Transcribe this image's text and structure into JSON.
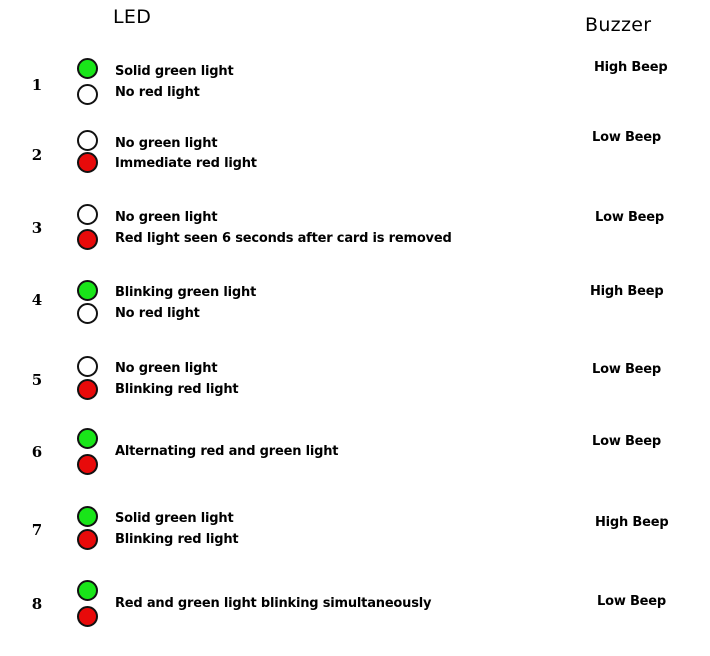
{
  "headers": {
    "led": "LED",
    "buzzer": "Buzzer"
  },
  "colors": {
    "green_on": "#19e519",
    "red_on": "#e80a0a",
    "off": "#ffffff",
    "outline": "#111111"
  },
  "rows": [
    {
      "number": "1",
      "green": "on",
      "red": "off",
      "lines": [
        "Solid green light",
        "No red light"
      ],
      "buzzer": "High Beep"
    },
    {
      "number": "2",
      "green": "off",
      "red": "on",
      "lines": [
        "No green light",
        "Immediate red light"
      ],
      "buzzer": "Low Beep"
    },
    {
      "number": "3",
      "green": "off",
      "red": "on",
      "lines": [
        "No green light",
        "Red light seen 6 seconds after card is removed"
      ],
      "buzzer": "Low Beep"
    },
    {
      "number": "4",
      "green": "on",
      "red": "off",
      "lines": [
        "Blinking green light",
        "No red light"
      ],
      "buzzer": "High Beep"
    },
    {
      "number": "5",
      "green": "off",
      "red": "on",
      "lines": [
        "No green light",
        "Blinking red light"
      ],
      "buzzer": "Low Beep"
    },
    {
      "number": "6",
      "green": "on",
      "red": "on",
      "lines": [
        "Alternating red and green light"
      ],
      "buzzer": "Low Beep"
    },
    {
      "number": "7",
      "green": "on",
      "red": "on",
      "lines": [
        "Solid green light",
        "Blinking red light"
      ],
      "buzzer": "High Beep"
    },
    {
      "number": "8",
      "green": "on",
      "red": "on",
      "lines": [
        "Red and green light blinking simultaneously"
      ],
      "buzzer": "Low Beep"
    }
  ]
}
